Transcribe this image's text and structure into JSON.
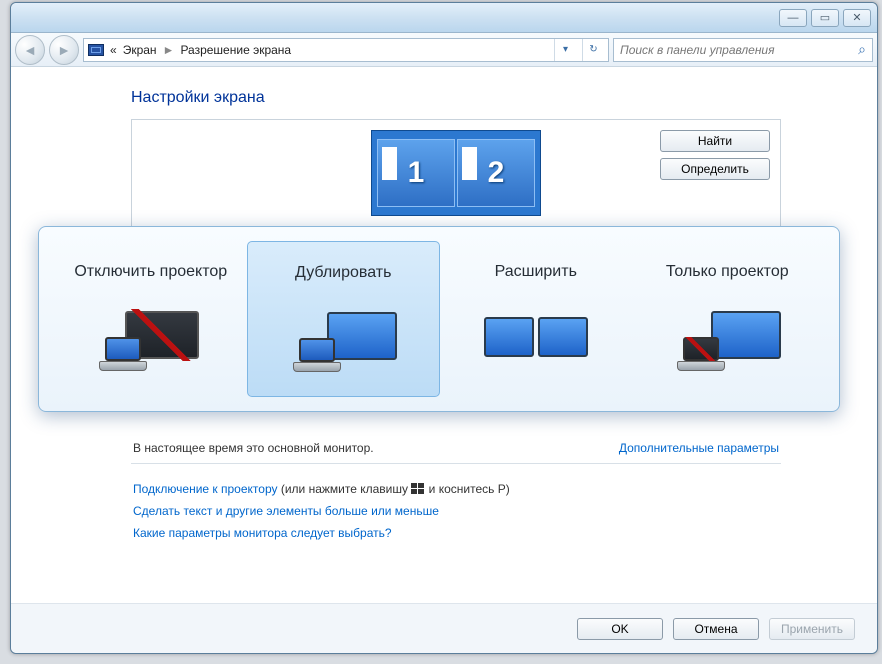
{
  "title_controls": {
    "minimize": "—",
    "maximize": "▭",
    "close": "✕"
  },
  "nav": {
    "back": "◄",
    "forward": "►",
    "crumb_prefix": "«",
    "crumb1": "Экран",
    "crumb_sep": "►",
    "crumb2": "Разрешение экрана",
    "dropdown": "▾",
    "refresh": "↻"
  },
  "search": {
    "placeholder": "Поиск в панели управления"
  },
  "page": {
    "title": "Настройки экрана",
    "find_btn": "Найти",
    "identify_btn": "Определить",
    "monitor1": "1",
    "monitor2": "2",
    "status": "В настоящее время это основной монитор.",
    "adv_link": "Дополнительные параметры",
    "link_projector_a": "Подключение к проектору",
    "link_projector_b": " (или нажмите клавишу ",
    "link_projector_c": " и коснитесь P)",
    "link_text_size": "Сделать текст и другие элементы больше или меньше",
    "link_which": "Какие параметры монитора следует выбрать?"
  },
  "popup": {
    "options": [
      {
        "label": "Отключить проектор"
      },
      {
        "label": "Дублировать"
      },
      {
        "label": "Расширить"
      },
      {
        "label": "Только проектор"
      }
    ]
  },
  "footer": {
    "ok": "OK",
    "cancel": "Отмена",
    "apply": "Применить"
  }
}
